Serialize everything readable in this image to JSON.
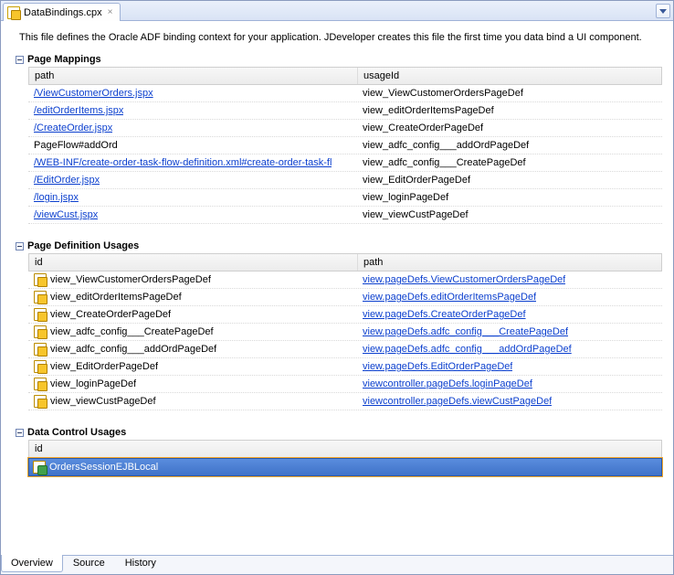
{
  "tab": {
    "title": "DataBindings.cpx"
  },
  "description": "This file defines the Oracle ADF binding context for your application. JDeveloper creates this file the first time you data bind a UI component.",
  "sections": {
    "pageMappings": {
      "title": "Page Mappings",
      "columns": {
        "a": "path",
        "b": "usageId"
      },
      "rows": [
        {
          "path": "/ViewCustomerOrders.jspx",
          "pathLink": true,
          "usageId": "view_ViewCustomerOrdersPageDef"
        },
        {
          "path": "/editOrderItems.jspx",
          "pathLink": true,
          "usageId": "view_editOrderItemsPageDef"
        },
        {
          "path": "/CreateOrder.jspx",
          "pathLink": true,
          "usageId": "view_CreateOrderPageDef"
        },
        {
          "path": "PageFlow#addOrd",
          "pathLink": false,
          "usageId": "view_adfc_config___addOrdPageDef"
        },
        {
          "path": "/WEB-INF/create-order-task-flow-definition.xml#create-order-task-fl",
          "pathLink": true,
          "usageId": "view_adfc_config___CreatePageDef"
        },
        {
          "path": "/EditOrder.jspx",
          "pathLink": true,
          "usageId": "view_EditOrderPageDef"
        },
        {
          "path": "/login.jspx",
          "pathLink": true,
          "usageId": "view_loginPageDef"
        },
        {
          "path": "/viewCust.jspx",
          "pathLink": true,
          "usageId": "view_viewCustPageDef"
        }
      ]
    },
    "pageDefUsages": {
      "title": "Page Definition Usages",
      "columns": {
        "a": "id",
        "b": "path"
      },
      "rows": [
        {
          "id": "view_ViewCustomerOrdersPageDef",
          "path": "view.pageDefs.ViewCustomerOrdersPageDef"
        },
        {
          "id": "view_editOrderItemsPageDef",
          "path": "view.pageDefs.editOrderItemsPageDef"
        },
        {
          "id": "view_CreateOrderPageDef",
          "path": "view.pageDefs.CreateOrderPageDef"
        },
        {
          "id": "view_adfc_config___CreatePageDef",
          "path": "view.pageDefs.adfc_config___CreatePageDef"
        },
        {
          "id": "view_adfc_config___addOrdPageDef",
          "path": "view.pageDefs.adfc_config___addOrdPageDef"
        },
        {
          "id": "view_EditOrderPageDef",
          "path": "view.pageDefs.EditOrderPageDef"
        },
        {
          "id": "view_loginPageDef",
          "path": "viewcontroller.pageDefs.loginPageDef"
        },
        {
          "id": "view_viewCustPageDef",
          "path": "viewcontroller.pageDefs.viewCustPageDef"
        }
      ]
    },
    "dataControlUsages": {
      "title": "Data Control Usages",
      "column": "id",
      "rows": [
        {
          "id": "OrdersSessionEJBLocal",
          "selected": true
        }
      ]
    }
  },
  "bottomTabs": {
    "overview": "Overview",
    "source": "Source",
    "history": "History",
    "active": "overview"
  }
}
